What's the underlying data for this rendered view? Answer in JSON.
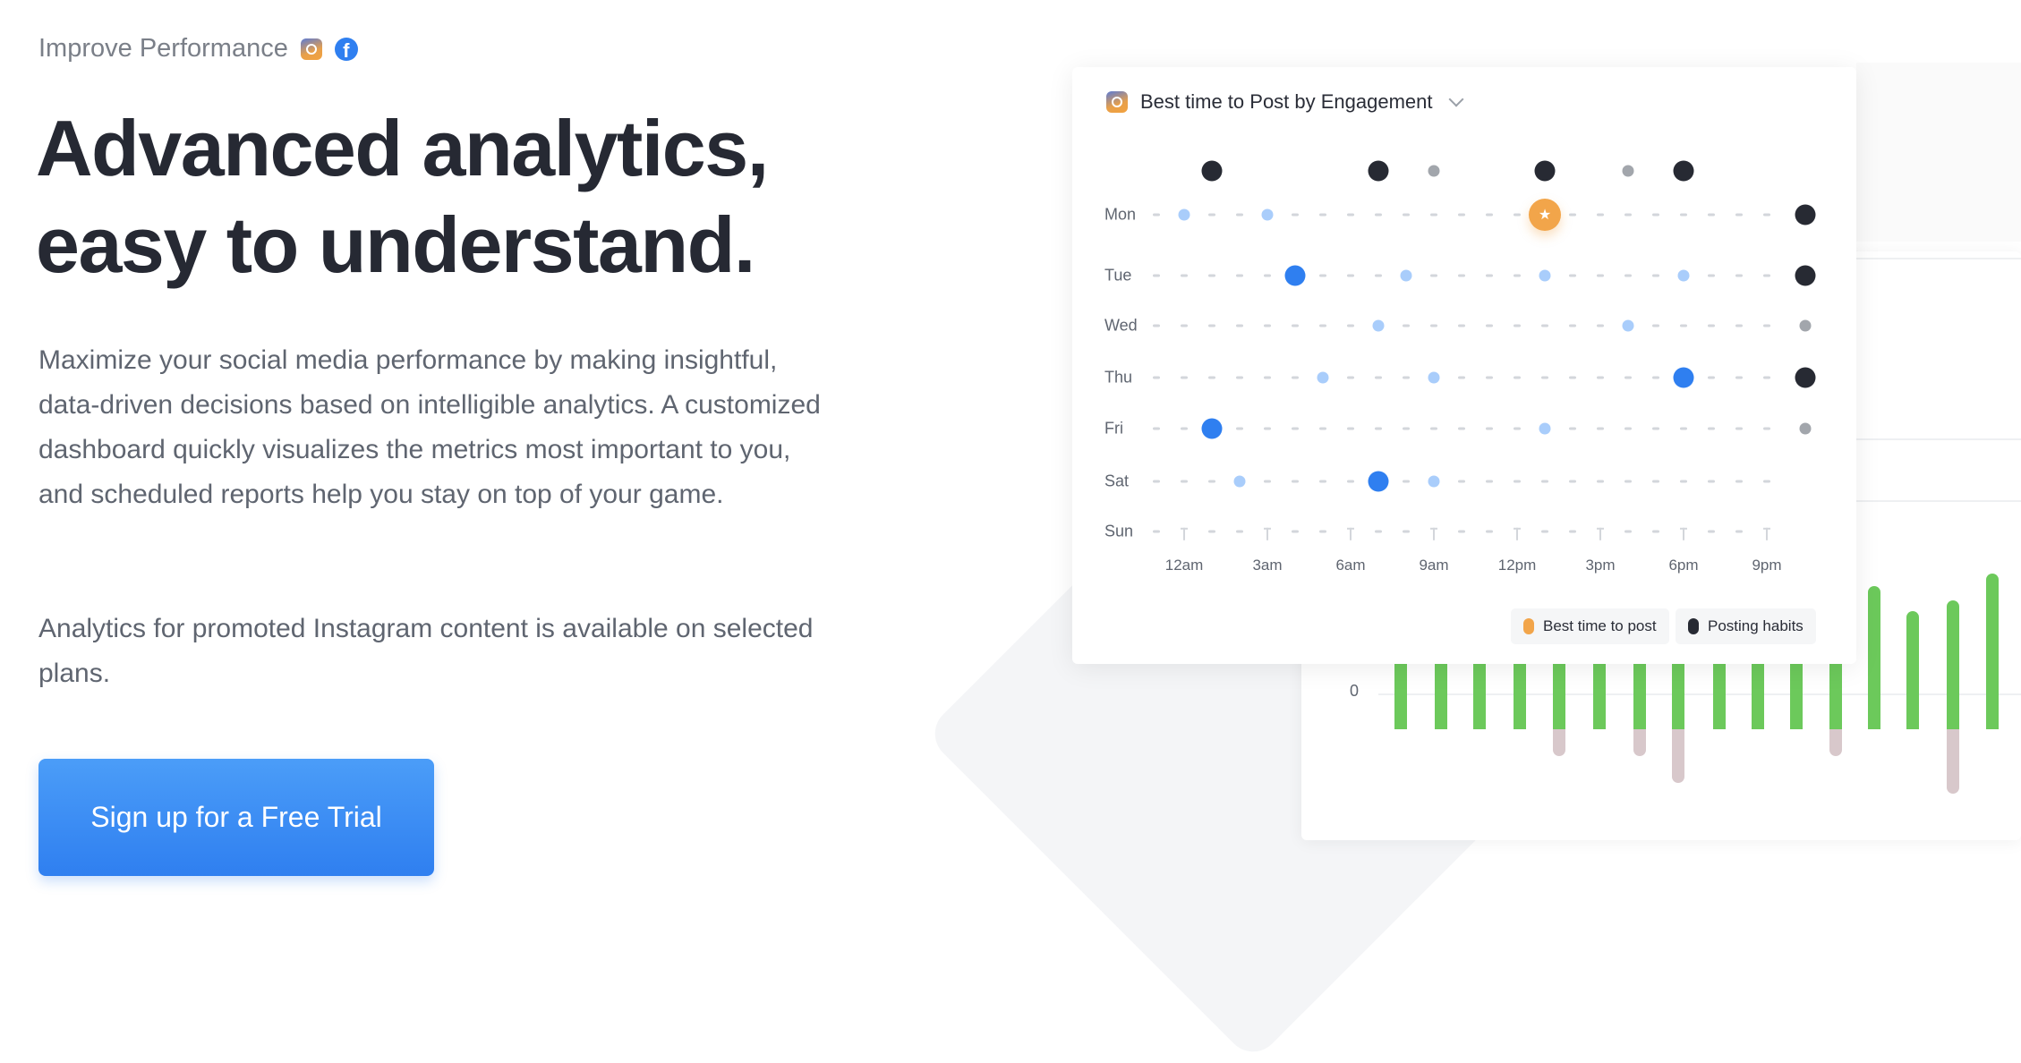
{
  "hero": {
    "eyebrow": "Improve Performance",
    "eyebrow_icons": [
      "instagram-icon",
      "facebook-icon"
    ],
    "facebook_glyph": "f",
    "title_line1": "Advanced analytics,",
    "title_line2": "easy to understand.",
    "paragraph1": "Maximize your social media performance by making insightful, data-driven decisions based on intelligible analytics. A customized dashboard quickly visualizes the metrics most important to you, and scheduled reports help you stay on top of your game.",
    "paragraph2": "Analytics for promoted Instagram content is available on selected plans.",
    "cta_label": "Sign up for a Free Trial"
  },
  "colors": {
    "accent": "#2f7ff0",
    "best_time": "#f2a54a",
    "posting_habits": "#272a33",
    "light_blue": "#a9cdfb",
    "gray_dot": "#a2a6ac",
    "bar_green": "#6cc95b",
    "bar_negative": "#d8c8cb"
  },
  "chart_data": [
    {
      "type": "scatter",
      "title": "Best time to Post by Engagement",
      "rows": [
        "",
        "Mon",
        "Tue",
        "Wed",
        "Thu",
        "Fri",
        "Sat",
        "Sun"
      ],
      "x_tick_labels": [
        "12am",
        "3am",
        "6am",
        "9am",
        "12pm",
        "3pm",
        "6pm",
        "9pm"
      ],
      "legend": [
        {
          "label": "Best time to post",
          "color": "#f2a54a"
        },
        {
          "label": "Posting habits",
          "color": "#272a33"
        }
      ],
      "points": [
        {
          "row": 0,
          "slot": 2,
          "kind": "habit"
        },
        {
          "row": 0,
          "slot": 8,
          "kind": "habit"
        },
        {
          "row": 0,
          "slot": 10,
          "kind": "habit-low"
        },
        {
          "row": 0,
          "slot": 14,
          "kind": "habit"
        },
        {
          "row": 0,
          "slot": 17,
          "kind": "habit-low"
        },
        {
          "row": 0,
          "slot": 19,
          "kind": "habit"
        },
        {
          "row": 1,
          "slot": 1,
          "kind": "low"
        },
        {
          "row": 1,
          "slot": 4,
          "kind": "low"
        },
        {
          "row": 1,
          "slot": 14,
          "kind": "best"
        },
        {
          "row": 1,
          "slot": "total",
          "kind": "habit"
        },
        {
          "row": 2,
          "slot": 5,
          "kind": "high"
        },
        {
          "row": 2,
          "slot": 9,
          "kind": "low"
        },
        {
          "row": 2,
          "slot": 14,
          "kind": "low"
        },
        {
          "row": 2,
          "slot": 19,
          "kind": "low"
        },
        {
          "row": 2,
          "slot": "total",
          "kind": "habit"
        },
        {
          "row": 3,
          "slot": 8,
          "kind": "low"
        },
        {
          "row": 3,
          "slot": 17,
          "kind": "low"
        },
        {
          "row": 3,
          "slot": "total",
          "kind": "habit-low"
        },
        {
          "row": 4,
          "slot": 6,
          "kind": "low"
        },
        {
          "row": 4,
          "slot": 10,
          "kind": "low"
        },
        {
          "row": 4,
          "slot": 19,
          "kind": "high"
        },
        {
          "row": 4,
          "slot": "total",
          "kind": "habit"
        },
        {
          "row": 5,
          "slot": 2,
          "kind": "high"
        },
        {
          "row": 5,
          "slot": 14,
          "kind": "low"
        },
        {
          "row": 5,
          "slot": "total",
          "kind": "habit-low"
        },
        {
          "row": 6,
          "slot": 3,
          "kind": "low"
        },
        {
          "row": 6,
          "slot": 8,
          "kind": "high"
        },
        {
          "row": 6,
          "slot": 10,
          "kind": "low"
        }
      ]
    },
    {
      "type": "bar",
      "y_tick_labels": [
        "0"
      ],
      "grid": true,
      "series": [
        {
          "values": [
            2.5,
            2.5,
            2.5,
            2.5,
            2.5,
            2.5,
            2.5,
            2.5,
            2.5,
            2.5,
            2.5,
            2.5,
            3.0,
            2.3,
            2.6,
            3.35
          ]
        },
        {
          "values": [
            0,
            0,
            0,
            0,
            -0.75,
            0,
            -0.75,
            -1.5,
            0,
            0,
            0,
            -0.75,
            0,
            0,
            -1.8,
            0
          ]
        }
      ]
    }
  ]
}
